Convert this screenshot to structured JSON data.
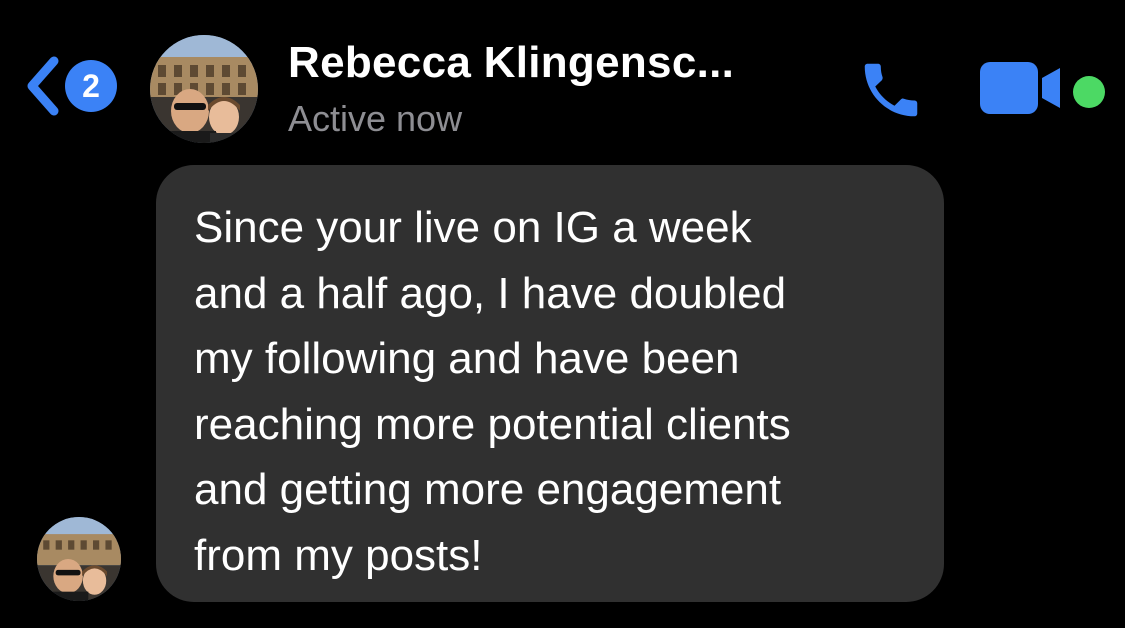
{
  "header": {
    "back_badge_count": "2",
    "contact_name": "Rebecca Klingensc...",
    "status": "Active now"
  },
  "colors": {
    "accent": "#3b82f6",
    "online": "#4cd964",
    "bubble": "#303030",
    "status_text": "#8e8e93"
  },
  "icons": {
    "back": "chevron-left-icon",
    "call": "phone-icon",
    "video": "video-camera-icon"
  },
  "messages": [
    {
      "text": "Since your live on IG a week\nand a half ago, I have doubled\nmy following and have been\nreaching more potential clients\nand getting more engagement\nfrom my posts!"
    }
  ]
}
